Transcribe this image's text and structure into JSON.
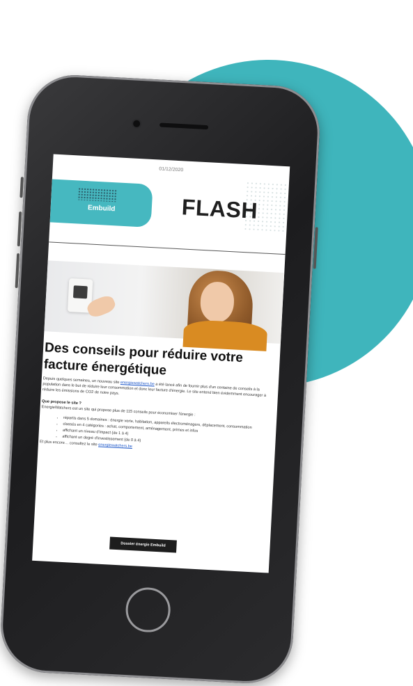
{
  "colors": {
    "accent": "#3fb5bc",
    "logo_bg": "#46b8c0",
    "cta_bg": "#1d1d1d"
  },
  "newsletter": {
    "date": "01/12/2020",
    "brand_name": "Embuild",
    "brand_tagline": "",
    "flash_label": "FLASH",
    "headline": "Des conseils pour réduire votre facture énergétique",
    "intro_1": "Depuis quelques semaines, un nouveau site ",
    "intro_link": "energiewatchers.be",
    "intro_2": " a été lancé afin de fournir plus d'un centaine de conseils à la population dans le but de réduire leur consommation et donc leur facture d'énergie. Le site entend bien évidemment encourager à réduire les émissions de CO2 de notre pays.",
    "question": "Que propose le site ?",
    "question_text": "EnergieWatchers est un site qui propose plus de 115 conseils pour économiser l'énergie :",
    "bullets": [
      "répartis dans 5 domaines : énergie verte, habitation, appareils électroménagers, déplacement, consommation",
      "classés en 4 catégories : achat, comportement, aménagement, primes et infos",
      "affichant un niveau d'impact (de 1 à 4)",
      "affichant un degré d'investissement (de 0 à 4)"
    ],
    "more_prefix": "Et plus encore… consultez le site ",
    "more_link": "energiewatchers.be",
    "cta_label": "Dossier énergie Embuild"
  }
}
